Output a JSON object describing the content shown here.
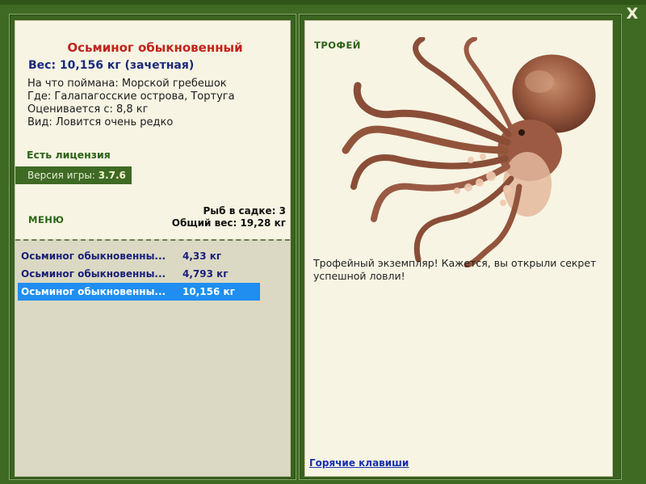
{
  "window": {
    "close_label": "X"
  },
  "fish": {
    "title": "Осьминог обыкновенный",
    "weight_line": "Вес: 10,156 кг (зачетная)",
    "info": [
      "На что поймана: Морской гребешок",
      "Где: Галапагосские острова, Тортуга",
      "Оценивается с: 8,8 кг",
      "Вид: Ловится очень редко"
    ]
  },
  "license": "Есть лицензия",
  "version": {
    "label": "Версия игры:",
    "value": "3.7.6"
  },
  "menu_label": "МЕНЮ",
  "cage": {
    "count_line": "Рыб в садке: 3",
    "total_line": "Общий вес: 19,28 кг"
  },
  "catch_list": [
    {
      "name": "Осьминог обыкновенны...",
      "weight": "4,33 кг",
      "selected": false
    },
    {
      "name": "Осьминог обыкновенны...",
      "weight": "4,793 кг",
      "selected": false
    },
    {
      "name": "Осьминог обыкновенны...",
      "weight": "10,156 кг",
      "selected": true
    }
  ],
  "trophy": {
    "label": "ТРОФЕЙ",
    "text": "Трофейный экземпляр! Кажется, вы открыли секрет успешной ловли!"
  },
  "hotkeys_link": "Горячие клавиши",
  "colors": {
    "frame_green": "#3e6a24",
    "panel_bg": "#f7f4e3",
    "list_bg": "#dbd9c3",
    "title_red": "#c0241c",
    "link_blue": "#1530b0",
    "selection_blue": "#1f8ef0"
  },
  "icons": {
    "close": "close-icon",
    "trophy_image": "octopus-image"
  }
}
